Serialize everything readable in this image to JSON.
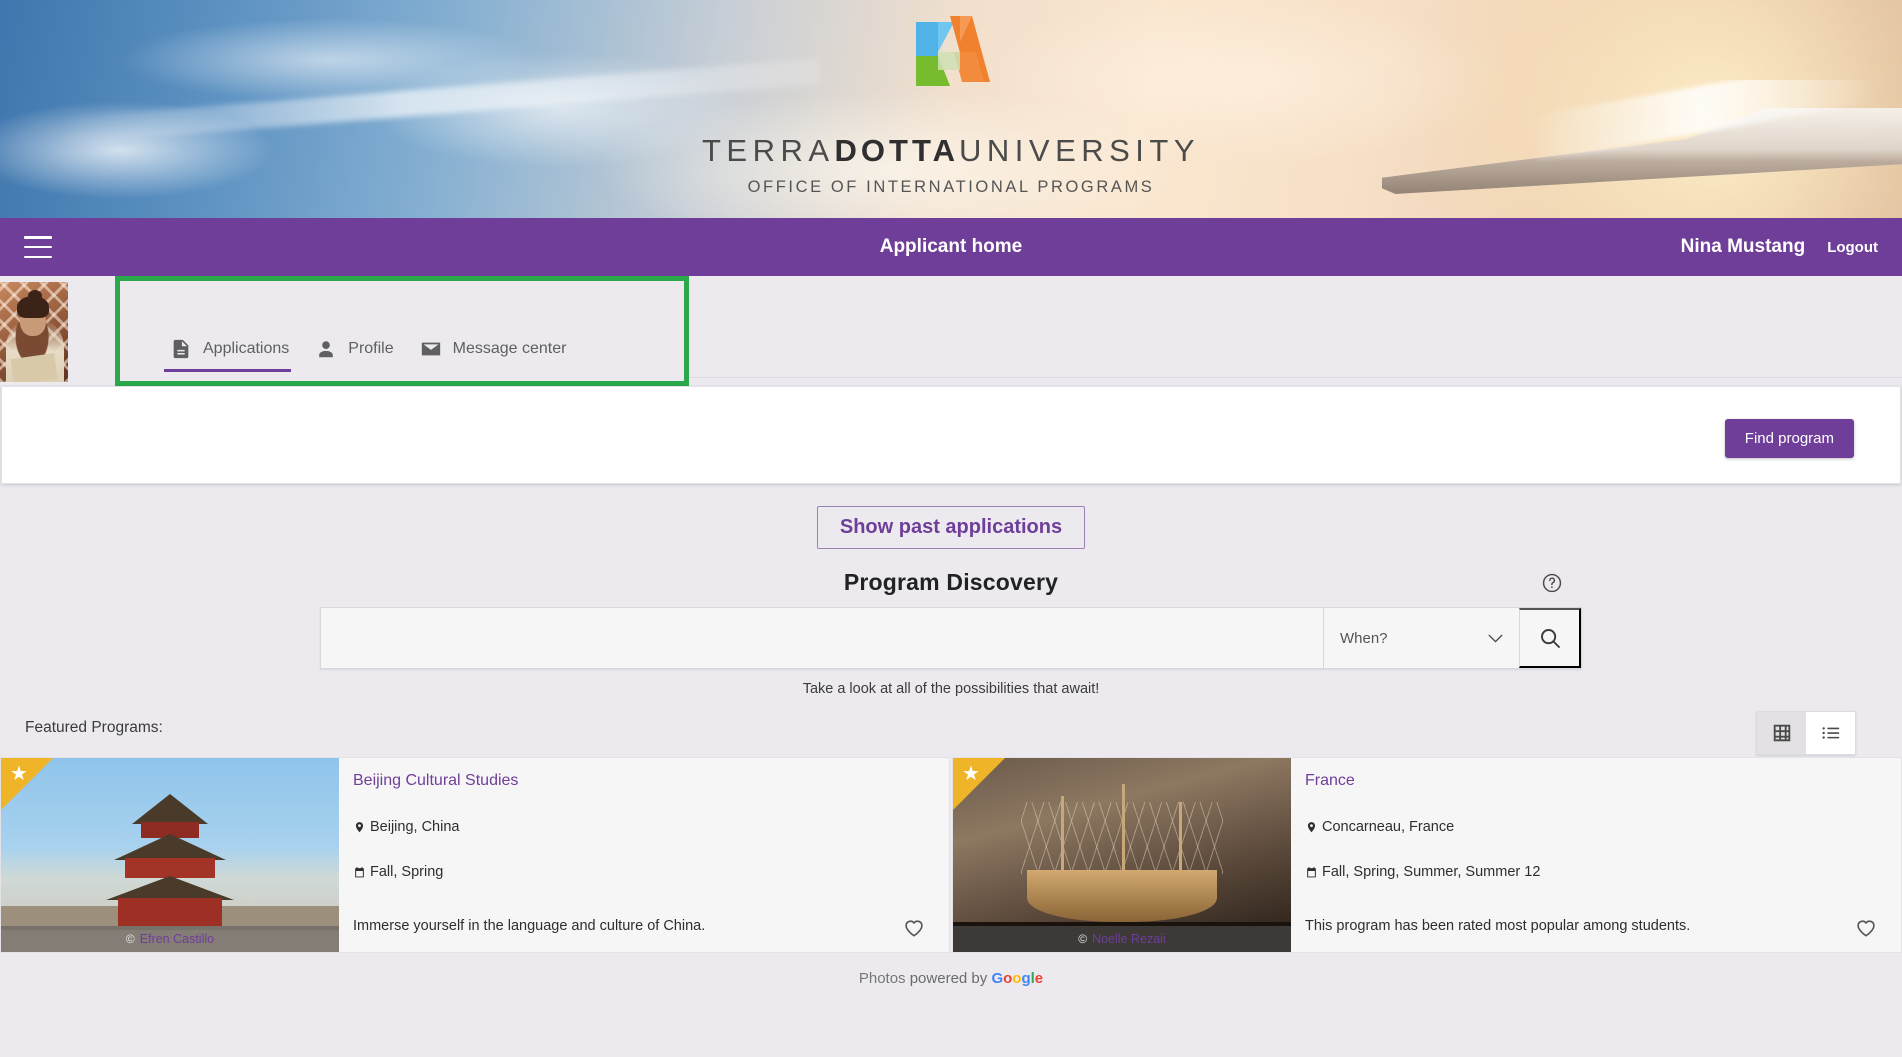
{
  "banner": {
    "brand_prefix": "TERRA",
    "brand_bold": "DOTTA",
    "brand_suffix": "UNIVERSITY",
    "subtitle": "OFFICE OF INTERNATIONAL PROGRAMS",
    "logo_icon": "terra-dotta-triangle-logo"
  },
  "navbar": {
    "menu_icon": "hamburger-menu-icon",
    "title": "Applicant home",
    "user_name": "Nina Mustang",
    "logout_label": "Logout",
    "background_color": "#6f3e99"
  },
  "tabs": {
    "highlight_color": "#2aa84a",
    "items": [
      {
        "label": "Applications",
        "icon": "document-icon",
        "active": true
      },
      {
        "label": "Profile",
        "icon": "person-icon",
        "active": false
      },
      {
        "label": "Message center",
        "icon": "envelope-icon",
        "active": false
      }
    ]
  },
  "panel": {
    "find_program_label": "Find program"
  },
  "discovery": {
    "show_past_label": "Show past applications",
    "title": "Program Discovery",
    "help_icon": "help-circle-icon",
    "search_placeholder": "",
    "search_value": "",
    "when_label": "When?",
    "when_chevron_icon": "chevron-down-icon",
    "search_icon": "search-icon",
    "tagline": "Take a look at all of the possibilities that await!"
  },
  "featured": {
    "label": "Featured Programs:",
    "view_modes": [
      {
        "name": "grid-view",
        "icon": "grid-icon",
        "active": true
      },
      {
        "name": "list-view",
        "icon": "list-icon",
        "active": false
      }
    ],
    "cards": [
      {
        "title": "Beijing Cultural Studies",
        "location": "Beijing, China",
        "terms": "Fall, Spring",
        "description": "Immerse yourself in the language and culture of China.",
        "photo_credit": "Efren Castillo",
        "credit_mark": "©",
        "featured_star": true,
        "favorite_icon": "heart-outline-icon",
        "location_icon": "map-pin-icon",
        "terms_icon": "calendar-icon"
      },
      {
        "title": "France",
        "location": "Concarneau, France",
        "terms": "Fall, Spring, Summer, Summer 12",
        "description": "This program has been rated most popular among students.",
        "photo_credit": "Noelle Rezaii",
        "credit_mark": "©",
        "featured_star": true,
        "favorite_icon": "heart-outline-icon",
        "location_icon": "map-pin-icon",
        "terms_icon": "calendar-icon"
      }
    ]
  },
  "footer": {
    "photos_word": "Photos",
    "powered_by": " powered by ",
    "google": {
      "g1": "G",
      "o1": "o",
      "o2": "o",
      "g2": "g",
      "l": "l",
      "e": "e"
    }
  }
}
